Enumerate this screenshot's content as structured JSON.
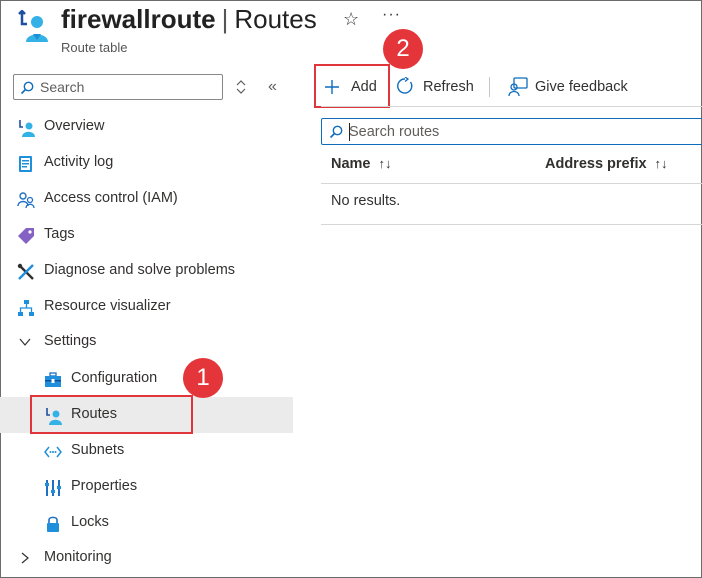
{
  "header": {
    "resource_name": "firewallroute",
    "separator": "|",
    "page_name": "Routes",
    "subtitle": "Route table",
    "favorite_icon": "star-icon",
    "more_icon": "ellipsis-icon",
    "more_glyph": "···"
  },
  "sidebar": {
    "search_placeholder": "Search",
    "items": [
      {
        "label": "Overview",
        "icon": "route-table-icon"
      },
      {
        "label": "Activity log",
        "icon": "activity-log-icon"
      },
      {
        "label": "Access control (IAM)",
        "icon": "people-icon"
      },
      {
        "label": "Tags",
        "icon": "tag-icon"
      },
      {
        "label": "Diagnose and solve problems",
        "icon": "wrench-icon"
      },
      {
        "label": "Resource visualizer",
        "icon": "hierarchy-icon"
      },
      {
        "label": "Settings",
        "icon": "chevron-down-icon",
        "expanded": true
      },
      {
        "label": "Configuration",
        "icon": "toolbox-icon"
      },
      {
        "label": "Routes",
        "icon": "route-table-icon",
        "selected": true
      },
      {
        "label": "Subnets",
        "icon": "subnet-icon"
      },
      {
        "label": "Properties",
        "icon": "properties-icon"
      },
      {
        "label": "Locks",
        "icon": "lock-icon"
      },
      {
        "label": "Monitoring",
        "icon": "chevron-right-icon",
        "expanded": false
      }
    ]
  },
  "toolbar": {
    "add_label": "Add",
    "refresh_label": "Refresh",
    "feedback_label": "Give feedback"
  },
  "content": {
    "search_placeholder": "Search routes",
    "columns": [
      "Name",
      "Address prefix"
    ],
    "sort_glyph": "↑↓",
    "empty_text": "No results."
  },
  "callouts": [
    {
      "number": "1",
      "target": "Routes"
    },
    {
      "number": "2",
      "target": "Add"
    }
  ],
  "colors": {
    "accent": "#0f6cbd",
    "icon_blue": "#1f8fdb",
    "callout_red": "#e3353a",
    "selected_bg": "#ebebeb"
  }
}
